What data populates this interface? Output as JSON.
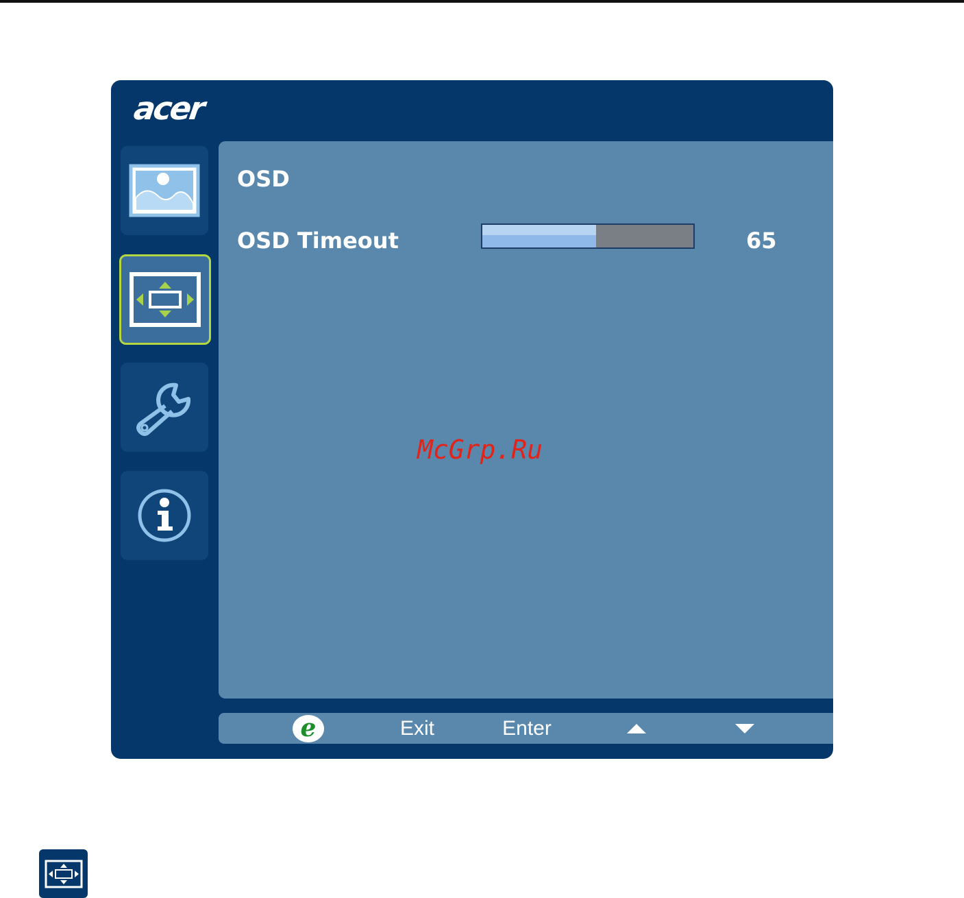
{
  "brand": {
    "logo_text": "acer"
  },
  "sidebar": {
    "tabs": [
      {
        "name": "picture",
        "icon": "picture-icon",
        "active": false
      },
      {
        "name": "osd",
        "icon": "osd-position-icon",
        "active": true
      },
      {
        "name": "settings",
        "icon": "wrench-icon",
        "active": false
      },
      {
        "name": "information",
        "icon": "info-icon",
        "active": false
      }
    ]
  },
  "panel": {
    "title": "OSD",
    "rows": [
      {
        "label": "OSD Timeout",
        "value": "65",
        "fraction": 0.54
      }
    ]
  },
  "watermark": "McGrp.Ru",
  "bottom_bar": {
    "e_label": "e",
    "exit_label": "Exit",
    "enter_label": "Enter",
    "up_icon": "triangle-up-icon",
    "down_icon": "triangle-down-icon"
  },
  "colors": {
    "window_bg": "#06376b",
    "panel_bg": "#5a88ad",
    "active_border": "#b4d640",
    "icon_accent": "#8fc1e9",
    "arrow_green": "#a8d24a",
    "e_green": "#1c8f2a",
    "watermark_red": "#e2231a"
  }
}
